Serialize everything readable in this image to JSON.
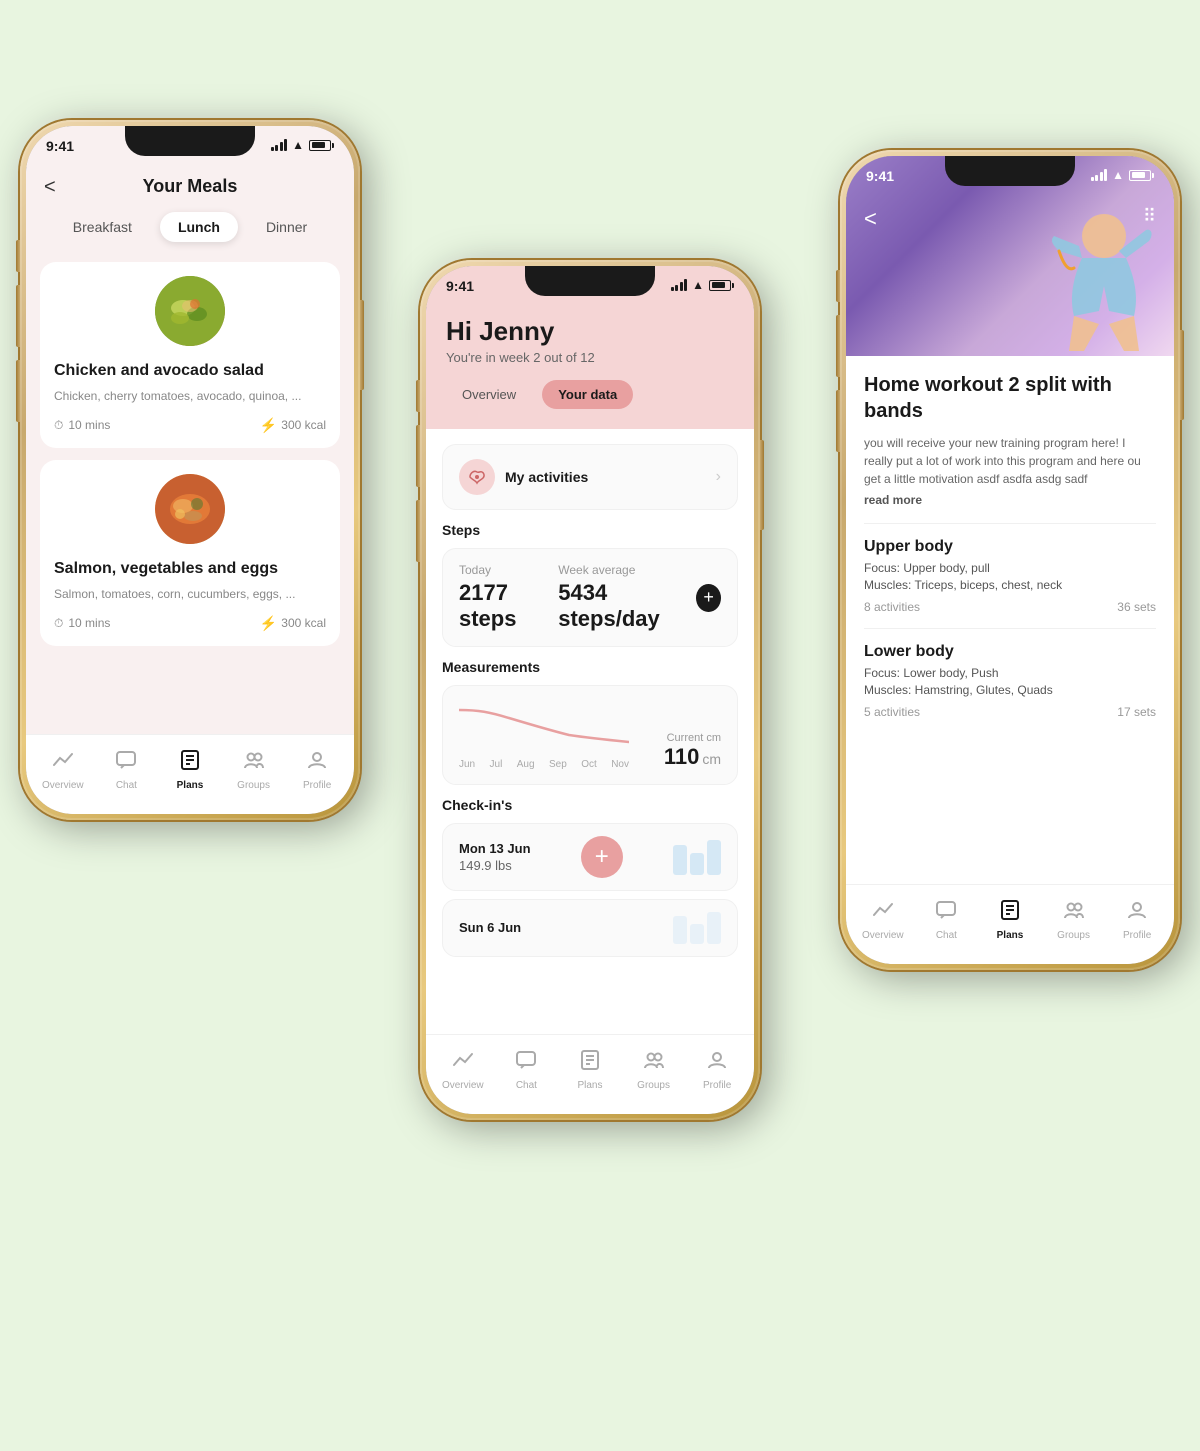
{
  "background_color": "#e8f5e0",
  "phone_left": {
    "status_time": "9:41",
    "title": "Your Meals",
    "back_label": "<",
    "tabs": [
      "Breakfast",
      "Lunch",
      "Dinner"
    ],
    "active_tab": "Lunch",
    "meals": [
      {
        "name": "Chicken and avocado salad",
        "description": "Chicken, cherry tomatoes, avocado, quinoa, ...",
        "time": "10 mins",
        "kcal": "300 kcal",
        "image_type": "salad"
      },
      {
        "name": "Salmon, vegetables and eggs",
        "description": "Salmon, tomatoes, corn, cucumbers, eggs, ...",
        "time": "10 mins",
        "kcal": "300 kcal",
        "image_type": "salmon"
      }
    ],
    "nav": [
      {
        "label": "Overview",
        "icon": "📈",
        "active": false
      },
      {
        "label": "Chat",
        "icon": "💬",
        "active": false
      },
      {
        "label": "Plans",
        "icon": "📄",
        "active": true
      },
      {
        "label": "Groups",
        "icon": "👥",
        "active": false
      },
      {
        "label": "Profile",
        "icon": "👤",
        "active": false
      }
    ]
  },
  "phone_center": {
    "status_time": "9:41",
    "greeting": "Hi Jenny",
    "week_info": "You're in week 2 out of 12",
    "tabs": [
      "Overview",
      "Your data"
    ],
    "active_tab": "Your data",
    "activity_label": "My activities",
    "steps_section": "Steps",
    "steps_today_label": "Today",
    "steps_today_value": "2177 steps",
    "steps_avg_label": "Week average",
    "steps_avg_value": "5434 steps/day",
    "measurements_label": "Measurements",
    "chart_labels": [
      "Jun",
      "Jul",
      "Aug",
      "Sep",
      "Oct",
      "Nov"
    ],
    "current_label": "Current cm",
    "current_value": "110",
    "current_unit": "cm",
    "checkins_label": "Check-in's",
    "checkins": [
      {
        "date": "Mon 13 Jun",
        "weight": "149.9 lbs",
        "has_add": true
      },
      {
        "date": "Sun 6 Jun",
        "weight": "",
        "has_add": false
      }
    ],
    "nav": [
      {
        "label": "Overview",
        "icon": "📈",
        "active": false
      },
      {
        "label": "Chat",
        "icon": "💬",
        "active": false
      },
      {
        "label": "Plans",
        "icon": "📄",
        "active": false
      },
      {
        "label": "Groups",
        "icon": "👥",
        "active": false
      },
      {
        "label": "Profile",
        "icon": "👤",
        "active": false
      }
    ]
  },
  "phone_right": {
    "status_time": "9:41",
    "back_label": "<",
    "workout_title": "Home workout 2 split with bands",
    "workout_desc": "you will receive your new training program here! I really put a lot of work into this program and here ou get a little motivation asdf asdfa asdg sadf",
    "read_more": "read more",
    "sections": [
      {
        "title": "Upper body",
        "focus": "Focus: Upper body, pull",
        "muscles": "Muscles: Triceps, biceps, chest, neck",
        "activities": "8 activities",
        "sets": "36 sets"
      },
      {
        "title": "Lower body",
        "focus": "Focus: Lower body, Push",
        "muscles": "Muscles: Hamstring, Glutes, Quads",
        "activities": "5 activities",
        "sets": "17 sets"
      }
    ],
    "nav": [
      {
        "label": "Overview",
        "icon": "📈",
        "active": false
      },
      {
        "label": "Chat",
        "icon": "💬",
        "active": false
      },
      {
        "label": "Plans",
        "icon": "📄",
        "active": true
      },
      {
        "label": "Groups",
        "icon": "👥",
        "active": false
      },
      {
        "label": "Profile",
        "icon": "👤",
        "active": false
      }
    ]
  }
}
